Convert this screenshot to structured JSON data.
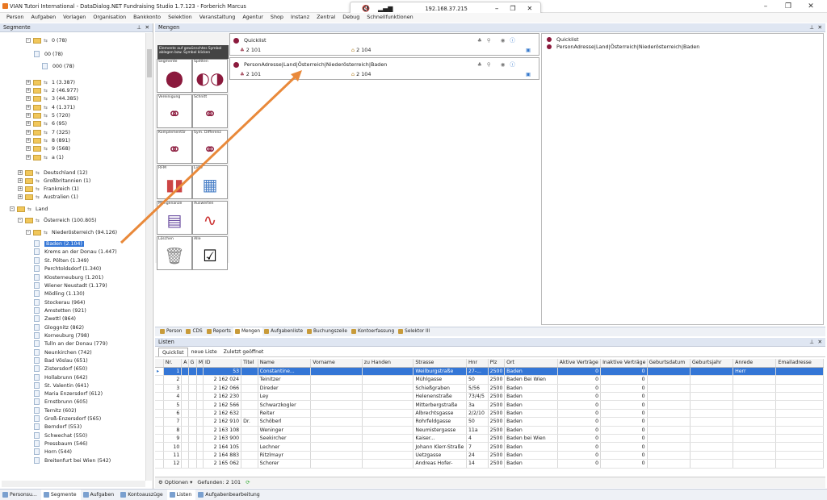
{
  "window": {
    "title": "VIAN Tutori International - DataDialog.NET Fundraising Studio 1.7.123 - Forberich Marcus"
  },
  "remote": {
    "ip": "192.168.37.215"
  },
  "menu": [
    "Person",
    "Aufgaben",
    "Vorlagen",
    "Organisation",
    "Bankkonto",
    "Selektion",
    "Veranstaltung",
    "Agentur",
    "Shop",
    "Instanz",
    "Zentral",
    "Debug",
    "Schnellfunktionen"
  ],
  "segmente": {
    "title": "Segmente",
    "nodes": [
      {
        "label": "0 (78)"
      },
      {
        "label": "00 (78)"
      },
      {
        "label": "000 (78)"
      },
      {
        "label": "1 (3.387)"
      },
      {
        "label": "2 (46.977)"
      },
      {
        "label": "3 (44.385)"
      },
      {
        "label": "4 (1.371)"
      },
      {
        "label": "5 (720)"
      },
      {
        "label": "6 (95)"
      },
      {
        "label": "7 (325)"
      },
      {
        "label": "8 (891)"
      },
      {
        "label": "9 (568)"
      },
      {
        "label": "a (1)"
      },
      {
        "label": "Deutschland (12)"
      },
      {
        "label": "Großbritannien (1)"
      },
      {
        "label": "Frankreich (1)"
      },
      {
        "label": "Australien (1)"
      },
      {
        "label": "Land"
      },
      {
        "label": "Österreich (100.805)"
      },
      {
        "label": "Niederösterreich (94.126)"
      },
      {
        "label": "Baden (2.104)"
      },
      {
        "label": "Krems an der Donau (1.447)"
      },
      {
        "label": "St. Pölten (1.349)"
      },
      {
        "label": "Perchtoldsdorf (1.340)"
      },
      {
        "label": "Klosterneuburg (1.201)"
      },
      {
        "label": "Wiener Neustadt (1.179)"
      },
      {
        "label": "Mödling (1.130)"
      },
      {
        "label": "Stockerau (964)"
      },
      {
        "label": "Amstetten (921)"
      },
      {
        "label": "Zwettl (864)"
      },
      {
        "label": "Gloggnitz (862)"
      },
      {
        "label": "Korneuburg (798)"
      },
      {
        "label": "Tulln an der Donau (779)"
      },
      {
        "label": "Neunkirchen (742)"
      },
      {
        "label": "Bad Vöslau (651)"
      },
      {
        "label": "Zistersdorf (650)"
      },
      {
        "label": "Hollabrunn (642)"
      },
      {
        "label": "St. Valentin (641)"
      },
      {
        "label": "Maria Enzersdorf (612)"
      },
      {
        "label": "Ernstbrunn (605)"
      },
      {
        "label": "Ternitz (602)"
      },
      {
        "label": "Groß-Enzersdorf (565)"
      },
      {
        "label": "Berndorf (553)"
      },
      {
        "label": "Schwechat (550)"
      },
      {
        "label": "Pressbaum (546)"
      },
      {
        "label": "Horn (544)"
      },
      {
        "label": "Breitenfurt bei Wien (542)"
      }
    ]
  },
  "mengen": {
    "title": "Mengen",
    "hint": "Elemente auf gewünschtes Symbol ablegen bzw. Symbol klicken",
    "tools": [
      "Segmente",
      "Spiltten",
      "Vereinigung",
      "Schnitt",
      "Komplementär",
      "Sym. Differenz",
      "RFM",
      "Liste",
      "Mengenanze",
      "Auswerten",
      "Löschen",
      "Alle"
    ],
    "sets": [
      {
        "name": "Quicklist",
        "count_a": "2 101",
        "count_b": "2 104"
      },
      {
        "name": "PersonAdresse|Land|Österreich|Niederösterreich|Baden",
        "count_a": "2 101",
        "count_b": "2 104"
      }
    ],
    "tree": [
      "Quicklist",
      "PersonAdresse|Land|Österreich|Niederösterreich|Baden"
    ]
  },
  "tabs": [
    "Person",
    "CDS",
    "Reports",
    "Mengen",
    "Aufgabenliste",
    "Buchungszeile",
    "Kontoerfassung",
    "Selektor III"
  ],
  "listen": {
    "title": "Listen",
    "subtabs": [
      "Quicklist",
      "neue Liste",
      "Zuletzt geöffnet"
    ],
    "columns": [
      "",
      "Nr.",
      "A",
      "G",
      "M",
      "ID",
      "Titel",
      "Name",
      "Vorname",
      "zu Handen",
      "Strasse",
      "Hnr",
      "Plz",
      "Ort",
      "Aktive Verträge",
      "Inaktive Verträge",
      "Geburtsdatum",
      "Geburtsjahr",
      "Anrede",
      "Emailadresse"
    ],
    "rows": [
      [
        "1",
        "53",
        "",
        "Constantine...",
        "",
        "",
        "Weilburgstraße",
        "27-...",
        "2500",
        "Baden",
        "0",
        "0",
        "",
        "",
        "Herr",
        ""
      ],
      [
        "2",
        "2 162 024",
        "",
        "Teinitzer",
        "",
        "",
        "Mühlgasse",
        "50",
        "2500",
        "Baden Bei Wien",
        "0",
        "0",
        "",
        "",
        "",
        ""
      ],
      [
        "3",
        "2 162 066",
        "",
        "Direder",
        "",
        "",
        "Schießgraben",
        "5/56",
        "2500",
        "Baden",
        "0",
        "0",
        "",
        "",
        "",
        ""
      ],
      [
        "4",
        "2 162 230",
        "",
        "Ley",
        "",
        "",
        "Helenenstraße",
        "73/4/5",
        "2500",
        "Baden",
        "0",
        "0",
        "",
        "",
        "",
        ""
      ],
      [
        "5",
        "2 162 566",
        "",
        "Schwarzkogler",
        "",
        "",
        "Mitterbergstraße",
        "3a",
        "2500",
        "Baden",
        "0",
        "0",
        "",
        "",
        "",
        ""
      ],
      [
        "6",
        "2 162 632",
        "",
        "Reiter",
        "",
        "",
        "Albrechtsgasse",
        "2/2/10",
        "2500",
        "Baden",
        "0",
        "0",
        "",
        "",
        "",
        ""
      ],
      [
        "7",
        "2 162 910",
        "Dr.",
        "Schöberl",
        "",
        "",
        "Rohrfeldgasse",
        "50",
        "2500",
        "Baden",
        "0",
        "0",
        "",
        "",
        "",
        ""
      ],
      [
        "8",
        "2 163 108",
        "",
        "Weninger",
        "",
        "",
        "Neumistergasse",
        "11a",
        "2500",
        "Baden",
        "0",
        "0",
        "",
        "",
        "",
        ""
      ],
      [
        "9",
        "2 163 900",
        "",
        "Seekircher",
        "",
        "",
        "Kaiser...",
        "4",
        "2500",
        "Baden bei Wien",
        "0",
        "0",
        "",
        "",
        "",
        ""
      ],
      [
        "10",
        "2 164 105",
        "",
        "Lechner",
        "",
        "",
        "Johann Klerr-Straße",
        "7",
        "2500",
        "Baden",
        "0",
        "0",
        "",
        "",
        "",
        ""
      ],
      [
        "11",
        "2 164 883",
        "",
        "Ritzlmayr",
        "",
        "",
        "Uetzgasse",
        "24",
        "2500",
        "Baden",
        "0",
        "0",
        "",
        "",
        "",
        ""
      ],
      [
        "12",
        "2 165 062",
        "",
        "Schorer",
        "",
        "",
        "Andreas Hofer-",
        "14",
        "2500",
        "Baden",
        "0",
        "0",
        "",
        "",
        "",
        ""
      ]
    ],
    "options_label": "Optionen",
    "found": "Gefunden: 2 101"
  },
  "bottom_tabs_left": [
    "Personsu...",
    "Segmente",
    "Aufgaben",
    "Kontoauszüge"
  ],
  "bottom_tabs_right": [
    "Listen",
    "Aufgabenbearbeitung"
  ]
}
